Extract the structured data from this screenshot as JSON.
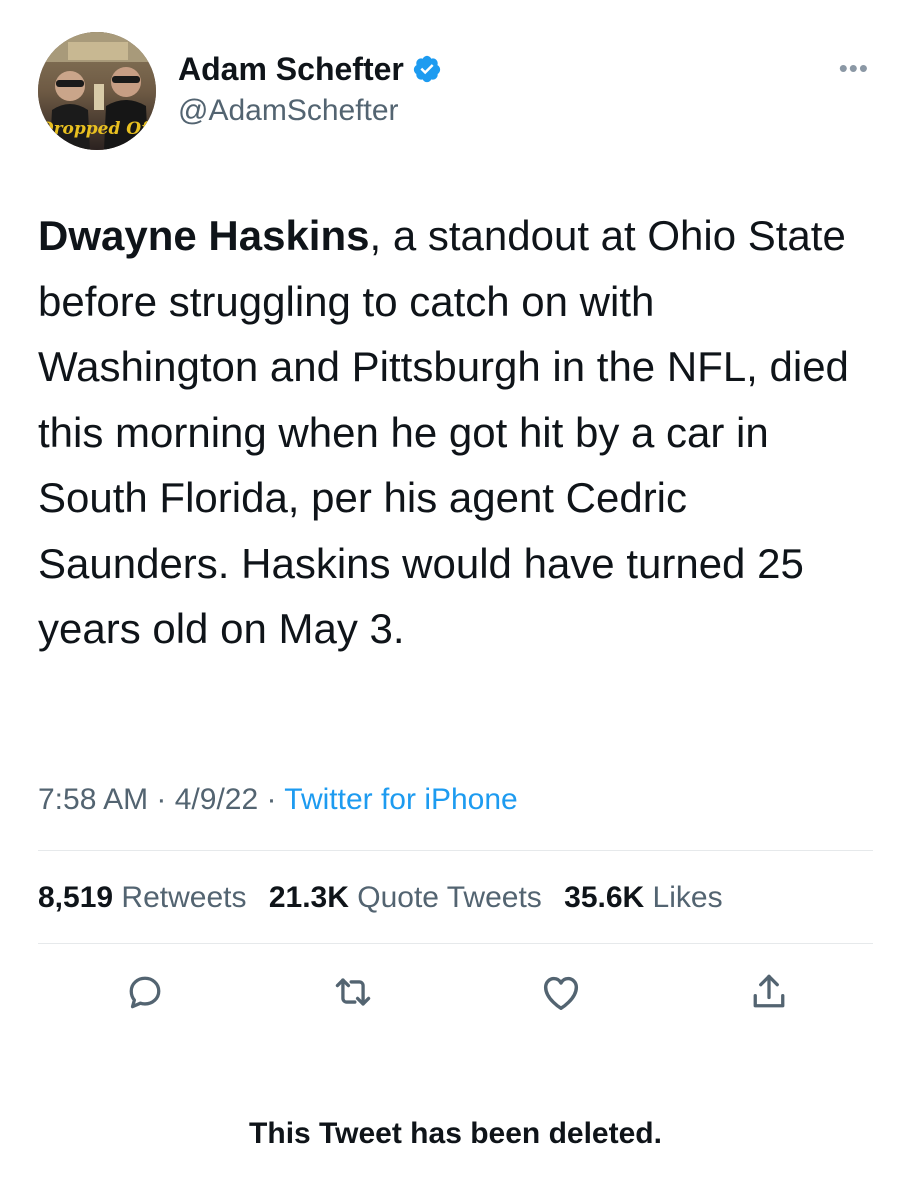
{
  "author": {
    "display_name": "Adam Schefter",
    "handle": "@AdamSchefter",
    "avatar_caption": "Dropped Off",
    "verified_color": "#1d9bf0"
  },
  "more_icon": "more-horizontal-icon",
  "tweet": {
    "bold_lead": "Dwayne Haskins",
    "text_rest": ", a standout at Ohio State before struggling to catch on with Washington and Pittsburgh in the NFL, died this morning when he got hit by a car in South Florida, per his agent Cedric Saunders. Haskins would have turned 25 years old on May 3."
  },
  "meta": {
    "time": "7:58 AM",
    "separator1": " · ",
    "date": "4/9/22",
    "separator2": " · ",
    "source": "Twitter for iPhone"
  },
  "stats": {
    "retweets_count": "8,519",
    "retweets_label": "Retweets",
    "quotes_count": "21.3K",
    "quotes_label": "Quote Tweets",
    "likes_count": "35.6K",
    "likes_label": "Likes"
  },
  "actions": [
    "reply-icon",
    "retweet-icon",
    "like-icon",
    "share-icon"
  ],
  "footer": {
    "deleted_notice": "This Tweet has been deleted."
  },
  "colors": {
    "text": "#0f1419",
    "secondary": "#536471",
    "link": "#1d9bf0",
    "divider": "#e6e9eb"
  }
}
